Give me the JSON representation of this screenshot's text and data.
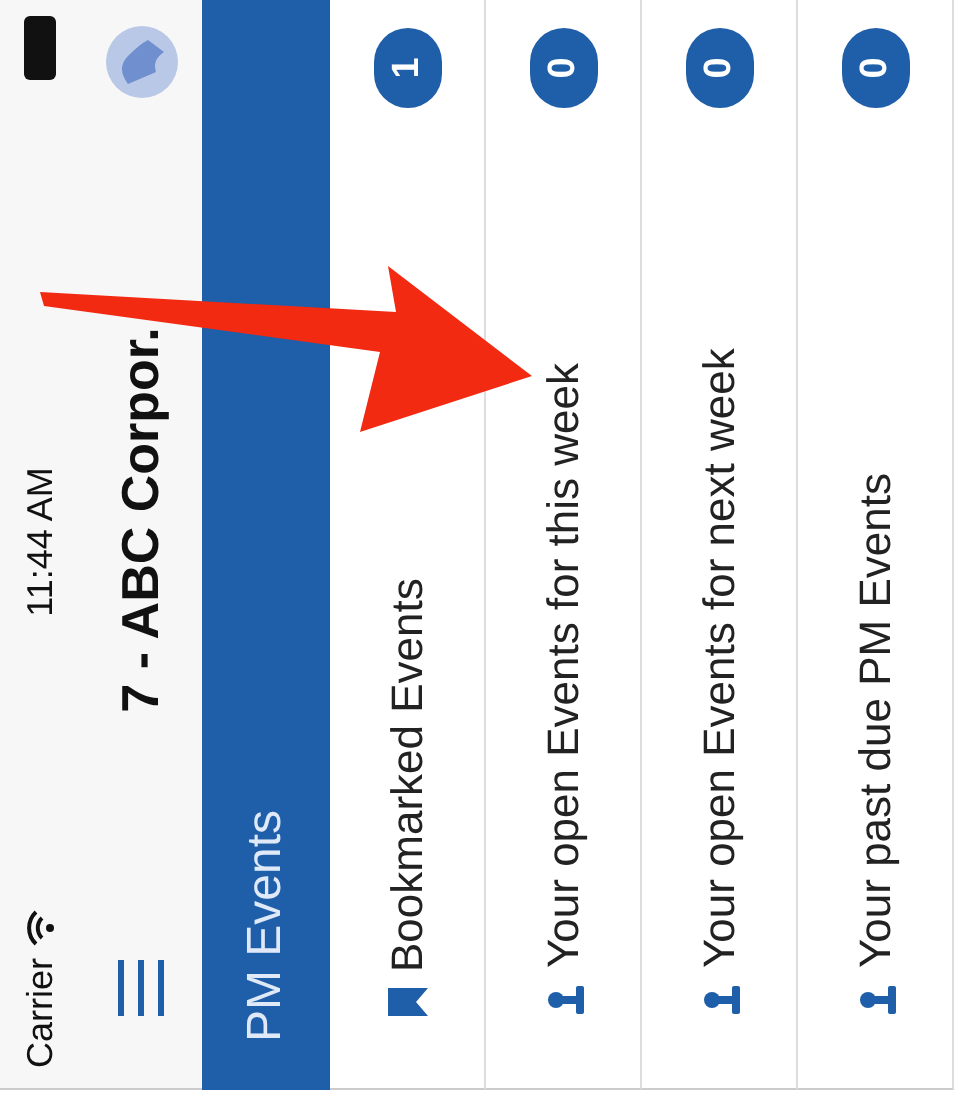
{
  "status_bar": {
    "carrier": "Carrier",
    "time": "11:44 AM"
  },
  "nav": {
    "title": "7 - ABC Corpor."
  },
  "section": {
    "title": "PM Events"
  },
  "rows": [
    {
      "kind": "bookmark",
      "label": "Bookmarked Events",
      "count": "1"
    },
    {
      "kind": "person",
      "label": "Your open Events for this week",
      "count": "0"
    },
    {
      "kind": "person",
      "label": "Your open Events for next week",
      "count": "0"
    },
    {
      "kind": "person",
      "label": "Your past due PM Events",
      "count": "0"
    }
  ]
}
